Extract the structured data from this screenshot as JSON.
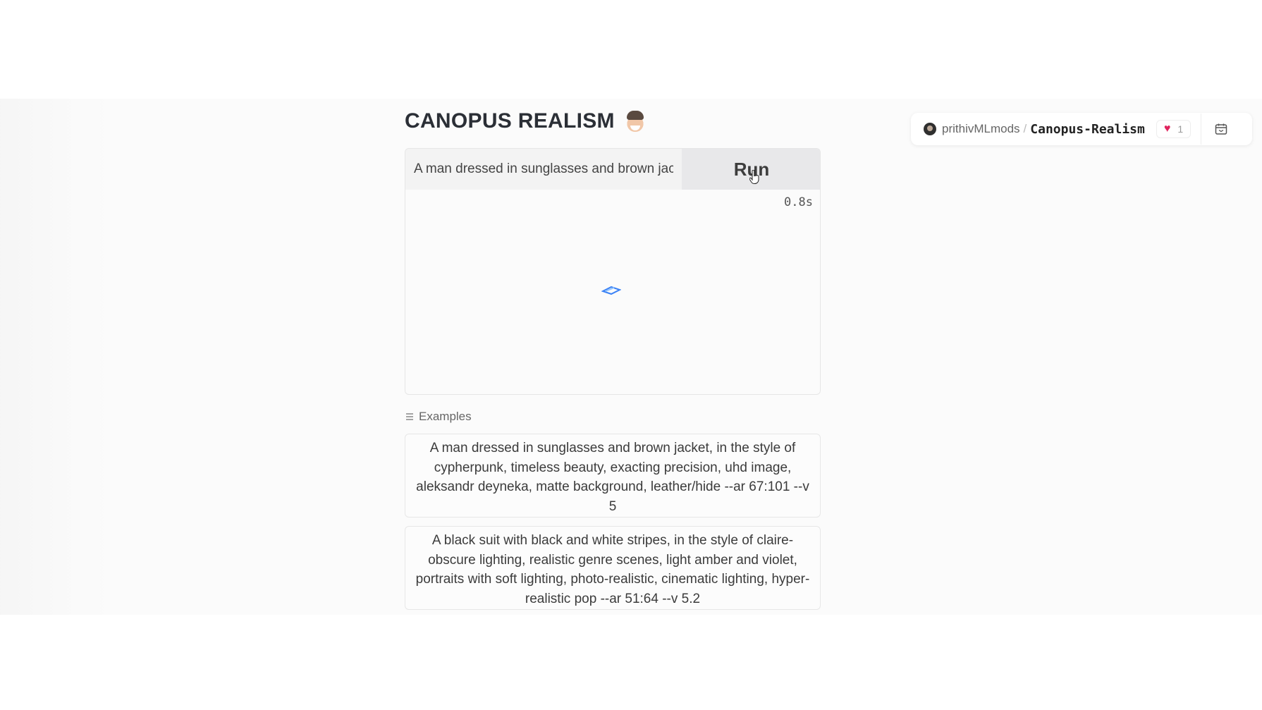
{
  "app": {
    "title": "CANOPUS REALISM",
    "title_icon": "face-emoji-icon",
    "prompt": {
      "value": "A man dressed in sunglasses and brown jacket, in the style of cypherpunk, timeless beauty, exacting precision, uhd image, aleksandr deyneka, matte background, leather/hide --ar 67:101 --v 5",
      "visible_value": "A man dressed in sunglasses and bro"
    },
    "run_label": "Run",
    "timer": "0.8s",
    "examples_label": "Examples",
    "examples": [
      "A man dressed in sunglasses and brown jacket, in the style of cypherpunk, timeless beauty, exacting precision, uhd image, aleksandr deyneka, matte background, leather/hide --ar 67:101 --v 5",
      "A black suit with black and white stripes, in the style of claire-obscure lighting, realistic genre scenes, light amber and violet, portraits with soft lighting, photo-realistic, cinematic lighting, hyper-realistic pop --ar 51:64 --v 5.2"
    ]
  },
  "header": {
    "owner": "prithivMLmods",
    "separator": "/",
    "space_name": "Canopus-Realism",
    "likes": "1"
  },
  "colors": {
    "heart": "#e0245e",
    "spinner": "#3b82f6"
  }
}
